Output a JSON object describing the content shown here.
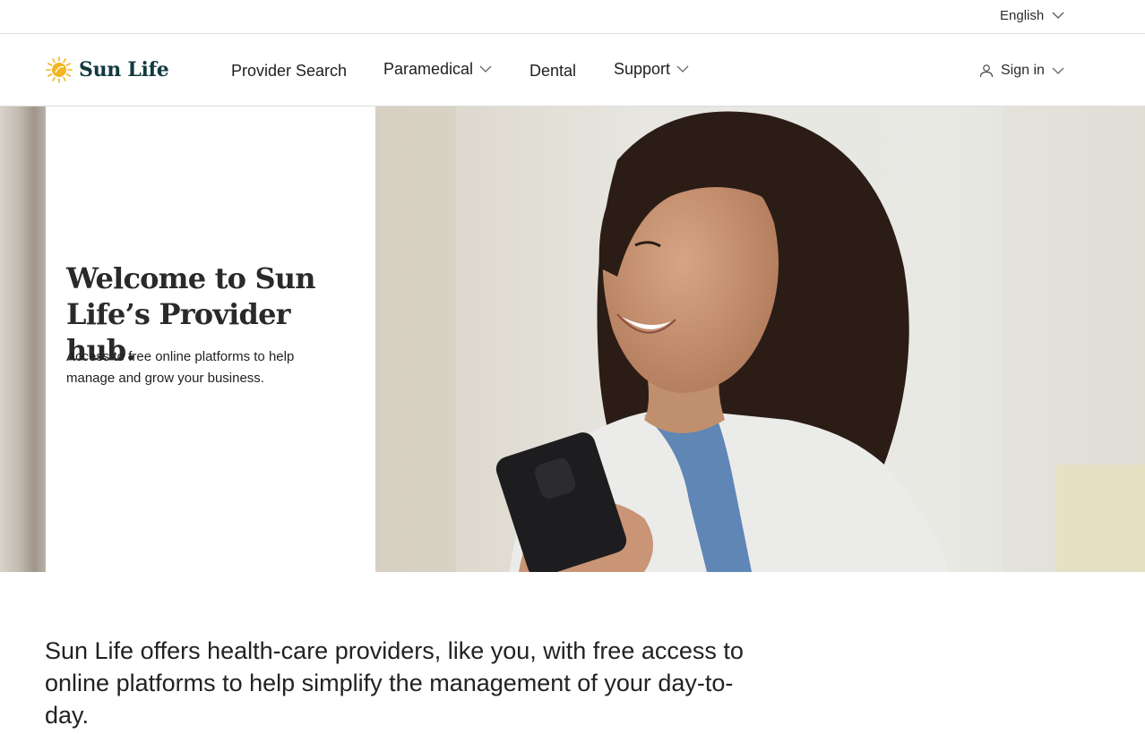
{
  "utility": {
    "language_label": "English"
  },
  "header": {
    "brand_name": "Sun Life",
    "nav": {
      "provider_search": "Provider Search",
      "paramedical": "Paramedical",
      "dental": "Dental",
      "support": "Support"
    },
    "sign_in_label": "Sign in"
  },
  "hero": {
    "title": "Welcome to Sun Life’s Provider hub.",
    "subtitle": "Access to free online platforms to help manage and grow your business.",
    "image_alt": "Smiling health-care provider in a white coat holding a smartphone"
  },
  "intro": {
    "text": "Sun Life offers health-care providers, like you, with free access to online platforms to help simplify the management of your day-to-day."
  },
  "colors": {
    "brand_navy": "#12393f",
    "brand_yellow": "#f2b51f",
    "divider": "#dcdcdc"
  },
  "icons": {
    "language_chevron": "chevron-down-icon",
    "logo": "sun-icon",
    "user": "user-icon"
  }
}
